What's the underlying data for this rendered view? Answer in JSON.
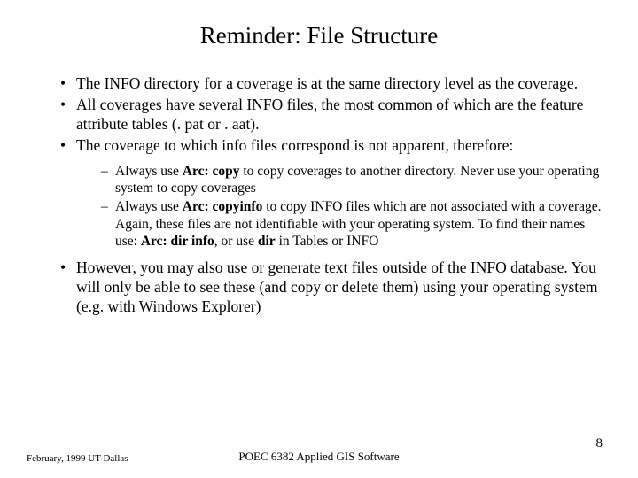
{
  "title": "Reminder:  File Structure",
  "bullets": {
    "b1": "The INFO directory for a coverage is at the same directory level as the coverage.",
    "b2": "All coverages have several INFO files, the most common of which are the feature attribute tables  (. pat or . aat).",
    "b3": "The coverage to which info files correspond is not apparent, therefore:",
    "b4": "However, you may also use or generate text files outside of the INFO database. You will only be able to see these (and copy or delete them) using your operating system (e.g. with Windows Explorer)"
  },
  "sub": {
    "s1_pre": "Always use ",
    "s1_bold": "Arc: copy",
    "s1_post": " to copy coverages to another directory.  Never use your operating system to copy coverages",
    "s2_pre": "Always use ",
    "s2_bold1": "Arc: copyinfo",
    "s2_mid1": " to copy INFO files which are not associated with a coverage.  Again, these files are not identifiable with your operating system. To find their names use: ",
    "s2_bold2": "Arc:  dir info",
    "s2_mid2": ",  or use ",
    "s2_bold3": "dir",
    "s2_post": " in Tables or INFO"
  },
  "footer": {
    "left": "February, 1999  UT Dallas",
    "center": "POEC 6382 Applied GIS Software",
    "right": "8"
  }
}
